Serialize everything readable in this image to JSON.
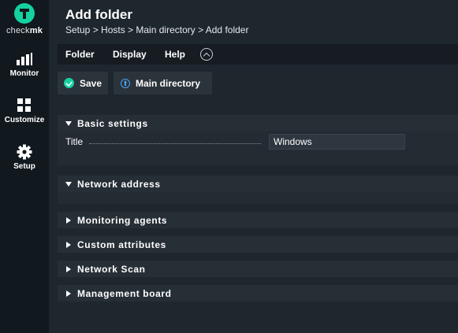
{
  "sidebar": {
    "logo_text_prefix": "check",
    "logo_text_suffix": "mk",
    "items": [
      {
        "label": "Monitor",
        "icon": "bar-chart-icon"
      },
      {
        "label": "Customize",
        "icon": "grid-icon"
      },
      {
        "label": "Setup",
        "icon": "gear-icon"
      }
    ]
  },
  "header": {
    "title": "Add folder",
    "breadcrumb": "Setup > Hosts > Main directory > Add folder"
  },
  "menubar": {
    "items": [
      "Folder",
      "Display",
      "Help"
    ],
    "toggle_icon": "chevron-up-circle-icon"
  },
  "toolbar": {
    "save_label": "Save",
    "main_directory_label": "Main directory"
  },
  "sections": {
    "basic_settings": {
      "label": "Basic settings",
      "expanded": true,
      "title_label": "Title",
      "title_value": "Windows"
    },
    "network_address": {
      "label": "Network address",
      "expanded": true
    },
    "collapsed": [
      {
        "label": "Monitoring agents"
      },
      {
        "label": "Custom attributes"
      },
      {
        "label": "Network Scan"
      },
      {
        "label": "Management board"
      }
    ]
  },
  "colors": {
    "accent": "#15d1a0",
    "link_icon": "#4ba3f5",
    "background": "#1e262e",
    "sidebar": "#11181e"
  }
}
